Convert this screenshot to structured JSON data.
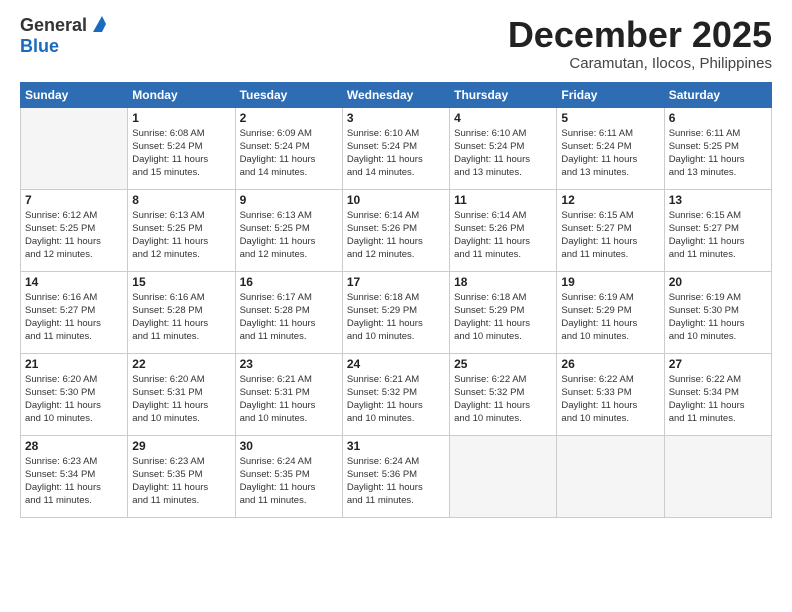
{
  "logo": {
    "general": "General",
    "blue": "Blue",
    "tagline": ""
  },
  "title": {
    "month": "December 2025",
    "location": "Caramutan, Ilocos, Philippines"
  },
  "weekdays": [
    "Sunday",
    "Monday",
    "Tuesday",
    "Wednesday",
    "Thursday",
    "Friday",
    "Saturday"
  ],
  "weeks": [
    [
      {
        "day": "",
        "info": ""
      },
      {
        "day": "1",
        "info": "Sunrise: 6:08 AM\nSunset: 5:24 PM\nDaylight: 11 hours\nand 15 minutes."
      },
      {
        "day": "2",
        "info": "Sunrise: 6:09 AM\nSunset: 5:24 PM\nDaylight: 11 hours\nand 14 minutes."
      },
      {
        "day": "3",
        "info": "Sunrise: 6:10 AM\nSunset: 5:24 PM\nDaylight: 11 hours\nand 14 minutes."
      },
      {
        "day": "4",
        "info": "Sunrise: 6:10 AM\nSunset: 5:24 PM\nDaylight: 11 hours\nand 13 minutes."
      },
      {
        "day": "5",
        "info": "Sunrise: 6:11 AM\nSunset: 5:24 PM\nDaylight: 11 hours\nand 13 minutes."
      },
      {
        "day": "6",
        "info": "Sunrise: 6:11 AM\nSunset: 5:25 PM\nDaylight: 11 hours\nand 13 minutes."
      }
    ],
    [
      {
        "day": "7",
        "info": "Sunrise: 6:12 AM\nSunset: 5:25 PM\nDaylight: 11 hours\nand 12 minutes."
      },
      {
        "day": "8",
        "info": "Sunrise: 6:13 AM\nSunset: 5:25 PM\nDaylight: 11 hours\nand 12 minutes."
      },
      {
        "day": "9",
        "info": "Sunrise: 6:13 AM\nSunset: 5:25 PM\nDaylight: 11 hours\nand 12 minutes."
      },
      {
        "day": "10",
        "info": "Sunrise: 6:14 AM\nSunset: 5:26 PM\nDaylight: 11 hours\nand 12 minutes."
      },
      {
        "day": "11",
        "info": "Sunrise: 6:14 AM\nSunset: 5:26 PM\nDaylight: 11 hours\nand 11 minutes."
      },
      {
        "day": "12",
        "info": "Sunrise: 6:15 AM\nSunset: 5:27 PM\nDaylight: 11 hours\nand 11 minutes."
      },
      {
        "day": "13",
        "info": "Sunrise: 6:15 AM\nSunset: 5:27 PM\nDaylight: 11 hours\nand 11 minutes."
      }
    ],
    [
      {
        "day": "14",
        "info": "Sunrise: 6:16 AM\nSunset: 5:27 PM\nDaylight: 11 hours\nand 11 minutes."
      },
      {
        "day": "15",
        "info": "Sunrise: 6:16 AM\nSunset: 5:28 PM\nDaylight: 11 hours\nand 11 minutes."
      },
      {
        "day": "16",
        "info": "Sunrise: 6:17 AM\nSunset: 5:28 PM\nDaylight: 11 hours\nand 11 minutes."
      },
      {
        "day": "17",
        "info": "Sunrise: 6:18 AM\nSunset: 5:29 PM\nDaylight: 11 hours\nand 10 minutes."
      },
      {
        "day": "18",
        "info": "Sunrise: 6:18 AM\nSunset: 5:29 PM\nDaylight: 11 hours\nand 10 minutes."
      },
      {
        "day": "19",
        "info": "Sunrise: 6:19 AM\nSunset: 5:29 PM\nDaylight: 11 hours\nand 10 minutes."
      },
      {
        "day": "20",
        "info": "Sunrise: 6:19 AM\nSunset: 5:30 PM\nDaylight: 11 hours\nand 10 minutes."
      }
    ],
    [
      {
        "day": "21",
        "info": "Sunrise: 6:20 AM\nSunset: 5:30 PM\nDaylight: 11 hours\nand 10 minutes."
      },
      {
        "day": "22",
        "info": "Sunrise: 6:20 AM\nSunset: 5:31 PM\nDaylight: 11 hours\nand 10 minutes."
      },
      {
        "day": "23",
        "info": "Sunrise: 6:21 AM\nSunset: 5:31 PM\nDaylight: 11 hours\nand 10 minutes."
      },
      {
        "day": "24",
        "info": "Sunrise: 6:21 AM\nSunset: 5:32 PM\nDaylight: 11 hours\nand 10 minutes."
      },
      {
        "day": "25",
        "info": "Sunrise: 6:22 AM\nSunset: 5:32 PM\nDaylight: 11 hours\nand 10 minutes."
      },
      {
        "day": "26",
        "info": "Sunrise: 6:22 AM\nSunset: 5:33 PM\nDaylight: 11 hours\nand 10 minutes."
      },
      {
        "day": "27",
        "info": "Sunrise: 6:22 AM\nSunset: 5:34 PM\nDaylight: 11 hours\nand 11 minutes."
      }
    ],
    [
      {
        "day": "28",
        "info": "Sunrise: 6:23 AM\nSunset: 5:34 PM\nDaylight: 11 hours\nand 11 minutes."
      },
      {
        "day": "29",
        "info": "Sunrise: 6:23 AM\nSunset: 5:35 PM\nDaylight: 11 hours\nand 11 minutes."
      },
      {
        "day": "30",
        "info": "Sunrise: 6:24 AM\nSunset: 5:35 PM\nDaylight: 11 hours\nand 11 minutes."
      },
      {
        "day": "31",
        "info": "Sunrise: 6:24 AM\nSunset: 5:36 PM\nDaylight: 11 hours\nand 11 minutes."
      },
      {
        "day": "",
        "info": ""
      },
      {
        "day": "",
        "info": ""
      },
      {
        "day": "",
        "info": ""
      }
    ]
  ]
}
